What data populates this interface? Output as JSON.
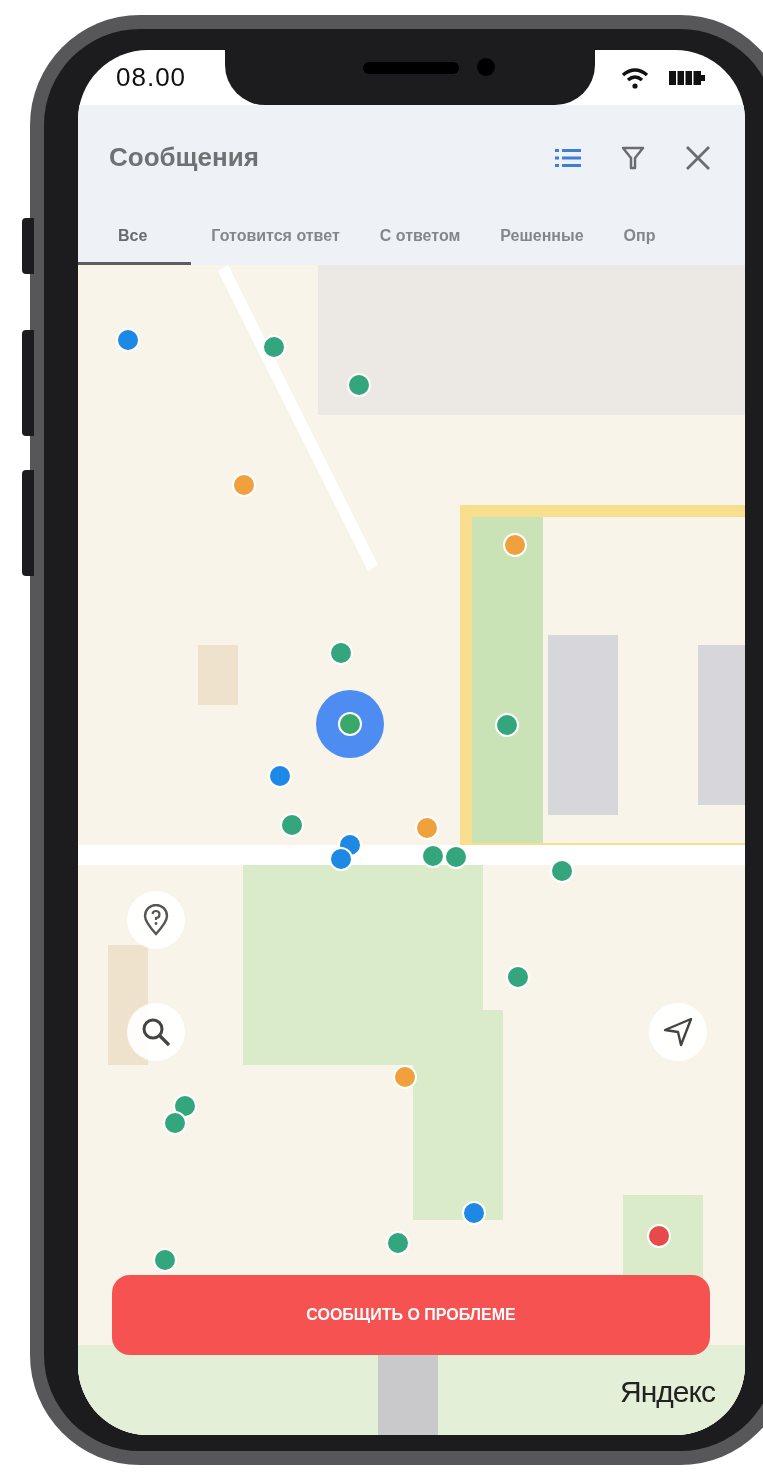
{
  "status_bar": {
    "time": "08.00"
  },
  "header": {
    "title": "Сообщения"
  },
  "tabs": [
    {
      "label": "Все",
      "selected": true
    },
    {
      "label": "Готовится ответ",
      "selected": false
    },
    {
      "label": "С ответом",
      "selected": false
    },
    {
      "label": "Решенные",
      "selected": false
    },
    {
      "label": "Опр",
      "selected": false
    }
  ],
  "map": {
    "markers": [
      {
        "color": "#1e88e5"
      },
      {
        "color": "#34a67e"
      },
      {
        "color": "#34a67e"
      },
      {
        "color": "#f0a03c"
      },
      {
        "color": "#f0a03c"
      },
      {
        "color": "#34a67e"
      },
      {
        "color": "#34a67e"
      },
      {
        "color": "#1e88e5"
      },
      {
        "color": "#34a67e"
      },
      {
        "color": "#f0a03c"
      },
      {
        "color": "#1e88e5"
      },
      {
        "color": "#1e88e5"
      },
      {
        "color": "#34a67e"
      },
      {
        "color": "#34a67e"
      },
      {
        "color": "#34a67e"
      },
      {
        "color": "#34a67e"
      },
      {
        "color": "#f0a03c"
      },
      {
        "color": "#34a67e"
      },
      {
        "color": "#34a67e"
      },
      {
        "color": "#1e88e5"
      },
      {
        "color": "#34a67e"
      },
      {
        "color": "#34a67e"
      },
      {
        "color": "#e84a4a"
      }
    ],
    "attribution": "Яндекс"
  },
  "report_button": {
    "label": "СООБЩИТЬ О ПРОБЛЕМЕ"
  }
}
